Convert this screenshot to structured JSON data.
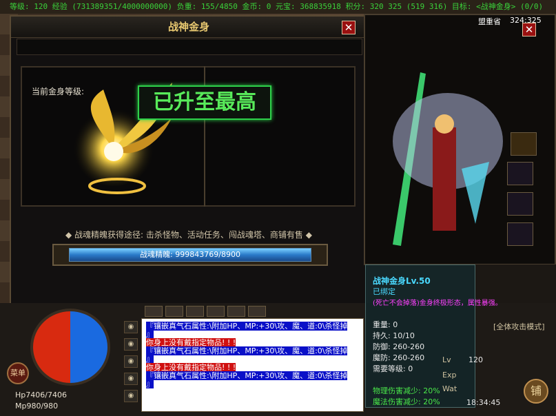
{
  "status_bar": {
    "text": "等级: 120 经验 (731389351/4000000000) 负重: 155/4850 金币: 0 元宝: 368835918 积分: 320 325 (519 316) 目标: <战神金身> (0/0)"
  },
  "dialog": {
    "title": "战神金身",
    "current_level_label": "当前金身等级:",
    "max_level_text": "已升至最高",
    "source_text": "◆ 战魂精魄获得途径: 击杀怪物、活动任务、闯战魂塔、商铺有售 ◆",
    "progress": {
      "text": "战魂精魄: 999843769/8900",
      "fill_fraction": 1.0
    }
  },
  "character_panel": {
    "map_name": "盟重省",
    "coords": "324:325"
  },
  "tooltip": {
    "item_name": "战神金身Lv.50",
    "bound": "已绑定",
    "note": "(死亡不会掉落)金身终极形态，属性暴强。",
    "stats": [
      {
        "label": "重量:",
        "value": "0"
      },
      {
        "label": "持久:",
        "value": "10/10"
      },
      {
        "label": "防御:",
        "value": "260-260"
      },
      {
        "label": "魔防:",
        "value": "260-260"
      },
      {
        "label": "需要等级:",
        "value": "0"
      }
    ],
    "reductions": [
      "物理伤害减少: 20%",
      "魔法伤害减少: 20%"
    ]
  },
  "hud": {
    "hp": "Hp7406/7406",
    "mp": "Mp980/980",
    "menu": "菜单",
    "attack_mode": "[全体攻击模式]",
    "level_label": "Lv",
    "level_value": "120",
    "exp_label": "Exp",
    "wt_label": "Wat",
    "time": "18:34:45",
    "shop": "铺",
    "side_buttons": [
      "◉",
      "◉",
      "◉",
      "◉",
      "◉"
    ]
  },
  "chat": {
    "messages": [
      {
        "type": "blue",
        "text": "『镶嵌真气石属性:\\附加HP、MP:+30\\攻、魔、道:0\\杀怪掉"
      },
      {
        "type": "blue",
        "text": "』"
      },
      {
        "type": "red",
        "text": "你身上没有戴指定物品! ! !"
      },
      {
        "type": "blue",
        "text": "『镶嵌真气石属性:\\附加HP、MP:+30\\攻、魔、道:0\\杀怪掉"
      },
      {
        "type": "blue",
        "text": "』"
      },
      {
        "type": "red",
        "text": "你身上没有戴指定物品! ! !"
      },
      {
        "type": "blue",
        "text": "『镶嵌真气石属性:\\附加HP、MP:+30\\攻、魔、道:0\\杀怪掉"
      },
      {
        "type": "blue",
        "text": "』"
      }
    ]
  },
  "colors": {
    "status_green": "#3ad13a",
    "maxed_green": "#58ea5a",
    "tooltip_name": "#4ad9ff",
    "tooltip_note": "#ff40ff",
    "tooltip_reduction": "#4ae84a",
    "progress_blue": "#2a7ac8"
  }
}
